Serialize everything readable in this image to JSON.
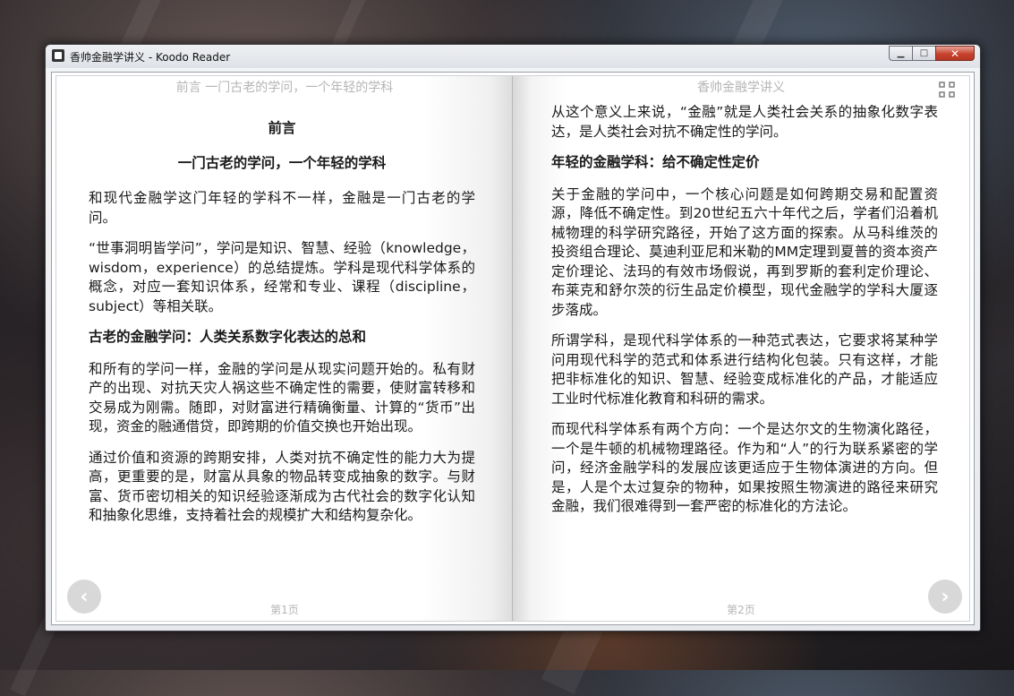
{
  "window": {
    "title": "香帅金融学讲义 - Koodo Reader",
    "min_label": "▁",
    "max_label": "□",
    "close_label": "✕"
  },
  "left_page": {
    "running_head": "前言 一门古老的学问，一个年轻的学科",
    "page_number": "第1页",
    "heading": "前言",
    "subheading": "一门古老的学问，一个年轻的学科",
    "p1": "和现代金融学这门年轻的学科不一样，金融是一门古老的学问。",
    "p2": "“世事洞明皆学问”，学问是知识、智慧、经验（knowledge，wisdom，experience）的总结提炼。学科是现代科学体系的概念，对应一套知识体系，经常和专业、课程（discipline，subject）等相关联。",
    "h_section": "古老的金融学问：人类关系数字化表达的总和",
    "p3": "和所有的学问一样，金融的学问是从现实问题开始的。私有财产的出现、对抗天灾人祸这些不确定性的需要，使财富转移和交易成为刚需。随即，对财富进行精确衡量、计算的“货币”出现，资金的融通借贷，即跨期的价值交换也开始出现。",
    "p4": "通过价值和资源的跨期安排，人类对抗不确定性的能力大为提高，更重要的是，财富从具象的物品转变成抽象的数字。与财富、货币密切相关的知识经验逐渐成为古代社会的数字化认知和抽象化思维，支持着社会的规模扩大和结构复杂化。"
  },
  "right_page": {
    "running_head": "香帅金融学讲义",
    "page_number": "第2页",
    "p1": "从这个意义上来说，“金融”就是人类社会关系的抽象化数字表达，是人类社会对抗不确定性的学问。",
    "h_section": "年轻的金融学科：给不确定性定价",
    "p2": "关于金融的学问中，一个核心问题是如何跨期交易和配置资源，降低不确定性。到20世纪五六十年代之后，学者们沿着机械物理的科学研究路径，开始了这方面的探索。从马科维茨的投资组合理论、莫迪利亚尼和米勒的MM定理到夏普的资本资产定价理论、法玛的有效市场假说，再到罗斯的套利定价理论、布莱克和舒尔茨的衍生品定价模型，现代金融学的学科大厦逐步落成。",
    "p3": "所谓学科，是现代科学体系的一种范式表达，它要求将某种学问用现代科学的范式和体系进行结构化包装。只有这样，才能把非标准化的知识、智慧、经验变成标准化的产品，才能适应工业时代标准化教育和科研的需求。",
    "p4": "而现代科学体系有两个方向：一个是达尔文的生物演化路径，一个是牛顿的机械物理路径。作为和“人”的行为联系紧密的学问，经济金融学科的发展应该更适应于生物体演进的方向。但是，人是个太过复杂的物种，如果按照生物演进的路径来研究金融，我们很难得到一套严密的标准化的方法论。"
  },
  "nav": {
    "prev_icon": "‹",
    "next_icon": "›"
  },
  "icons": {
    "app": "koodo-reader-icon",
    "grid": "grid-view-icon",
    "prev": "chevron-left-icon",
    "next": "chevron-right-icon"
  }
}
